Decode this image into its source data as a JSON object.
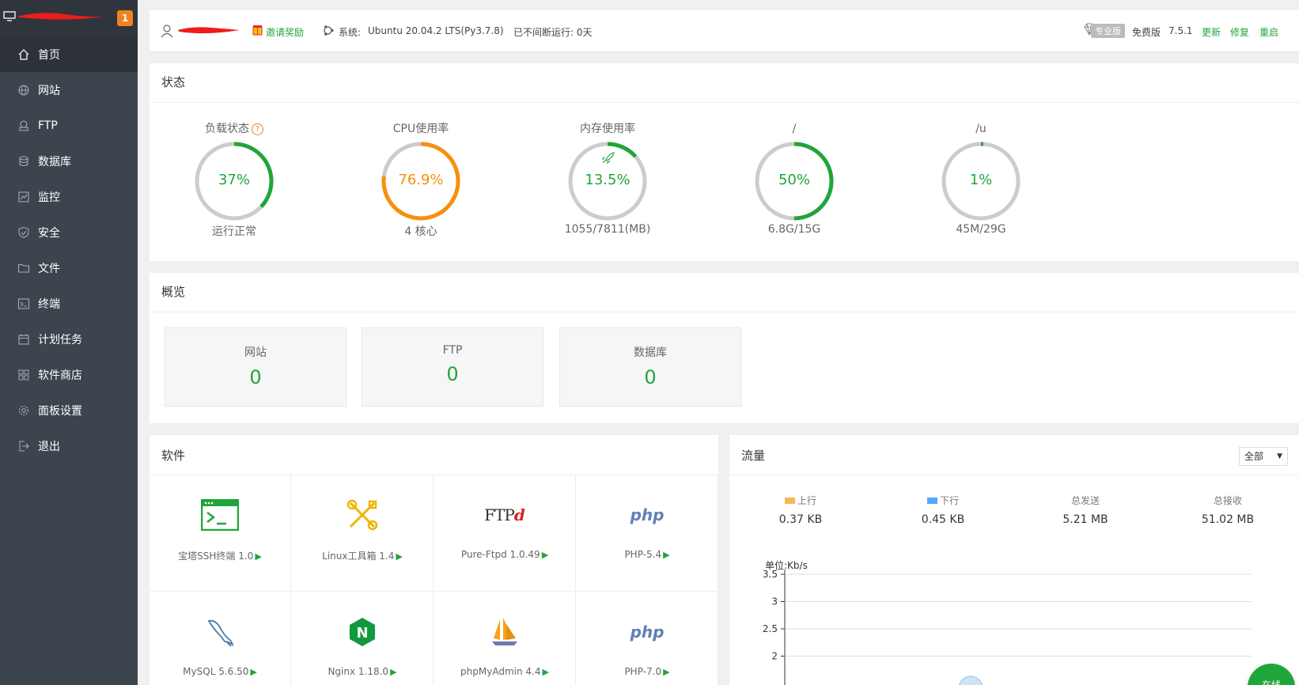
{
  "sidebar": {
    "badge": "1",
    "items": [
      {
        "label": "首页",
        "icon": "home-icon"
      },
      {
        "label": "网站",
        "icon": "globe-icon"
      },
      {
        "label": "FTP",
        "icon": "ftp-icon"
      },
      {
        "label": "数据库",
        "icon": "database-icon"
      },
      {
        "label": "监控",
        "icon": "monitor-chart-icon"
      },
      {
        "label": "安全",
        "icon": "shield-icon"
      },
      {
        "label": "文件",
        "icon": "folder-icon"
      },
      {
        "label": "终端",
        "icon": "terminal-icon"
      },
      {
        "label": "计划任务",
        "icon": "calendar-icon"
      },
      {
        "label": "软件商店",
        "icon": "grid-icon"
      },
      {
        "label": "面板设置",
        "icon": "gear-icon"
      },
      {
        "label": "退出",
        "icon": "logout-icon"
      }
    ]
  },
  "topbar": {
    "invite": "邀请奖励",
    "sys_label": "系统:",
    "sys_value": "Ubuntu 20.04.2 LTS(Py3.7.8)",
    "uptime": "已不间断运行: 0天",
    "pro": "专业版",
    "free": "免费版",
    "version": "7.5.1",
    "update": "更新",
    "repair": "修复",
    "restart": "重启"
  },
  "status": {
    "title": "状态",
    "gauges": [
      {
        "title": "负载状态",
        "value": "37%",
        "percent": 37,
        "sub": "运行正常",
        "color": "#20a53a",
        "help": "?"
      },
      {
        "title": "CPU使用率",
        "value": "76.9%",
        "percent": 76.9,
        "sub": "4 核心",
        "color": "#f7900c"
      },
      {
        "title": "内存使用率",
        "value": "13.5%",
        "percent": 13.5,
        "sub": "1055/7811(MB)",
        "color": "#20a53a"
      },
      {
        "title": "/",
        "value": "50%",
        "percent": 50,
        "sub": "6.8G/15G",
        "color": "#20a53a"
      },
      {
        "title": "/u",
        "value": "1%",
        "percent": 1,
        "sub": "45M/29G",
        "color": "#20a53a"
      }
    ]
  },
  "overview": {
    "title": "概览",
    "boxes": [
      {
        "label": "网站",
        "value": "0"
      },
      {
        "label": "FTP",
        "value": "0"
      },
      {
        "label": "数据库",
        "value": "0"
      }
    ]
  },
  "software": {
    "title": "软件",
    "items": [
      {
        "name": "宝塔SSH终端 1.0",
        "icon": "ssh-terminal-icon"
      },
      {
        "name": "Linux工具箱 1.4",
        "icon": "toolbox-icon"
      },
      {
        "name": "Pure-Ftpd 1.0.49",
        "icon": "pureftpd-icon",
        "logo": "FTP"
      },
      {
        "name": "PHP-5.4",
        "icon": "php-icon",
        "logo": "php"
      },
      {
        "name": "MySQL 5.6.50",
        "icon": "mysql-dolphin-icon"
      },
      {
        "name": "Nginx 1.18.0",
        "icon": "nginx-icon",
        "logo": "N"
      },
      {
        "name": "phpMyAdmin 4.4",
        "icon": "phpmyadmin-icon"
      },
      {
        "name": "PHP-7.0",
        "icon": "php-icon",
        "logo": "php"
      }
    ]
  },
  "traffic": {
    "title": "流量",
    "select": "全部",
    "stats": [
      {
        "label": "上行",
        "value": "0.37 KB",
        "swatch": "#f7b851"
      },
      {
        "label": "下行",
        "value": "0.45 KB",
        "swatch": "#52a9ff"
      },
      {
        "label": "总发送",
        "value": "5.21 MB"
      },
      {
        "label": "总接收",
        "value": "51.02 MB"
      }
    ],
    "unit": "单位:Kb/s"
  },
  "chart_data": {
    "type": "line",
    "ylabel": "单位:Kb/s",
    "yticks": [
      "3.5",
      "3",
      "2.5",
      "2"
    ],
    "grid": true
  },
  "online": "在线"
}
